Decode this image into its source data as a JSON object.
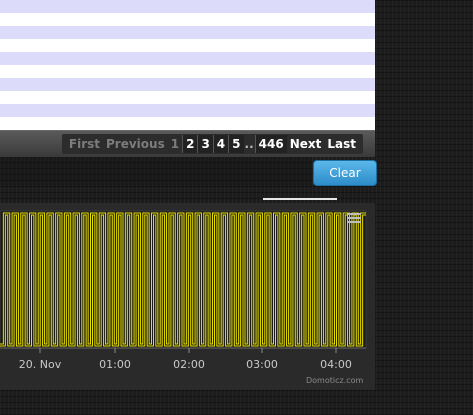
{
  "pager": {
    "first": "First",
    "previous": "Previous",
    "current": "1",
    "pages": [
      "2",
      "3",
      "4",
      "5"
    ],
    "ellipsis": "..",
    "last_page": "446",
    "next": "Next",
    "last": "Last"
  },
  "actions": {
    "clear_label": "Clear"
  },
  "chart": {
    "credits": "Domoticz.com",
    "menu_icon": "menu-icon",
    "series_color": "#e8e000",
    "plot_bg": "#1b1b1b"
  },
  "chart_data": {
    "type": "line",
    "title": "",
    "xlabel": "",
    "ylabel": "",
    "x_ticks": [
      "20. Nov",
      "01:00",
      "02:00",
      "03:00",
      "04:00"
    ],
    "series": [
      {
        "step": true,
        "values_pattern": [
          0,
          1
        ],
        "cycles": 42
      }
    ],
    "grid": false
  }
}
